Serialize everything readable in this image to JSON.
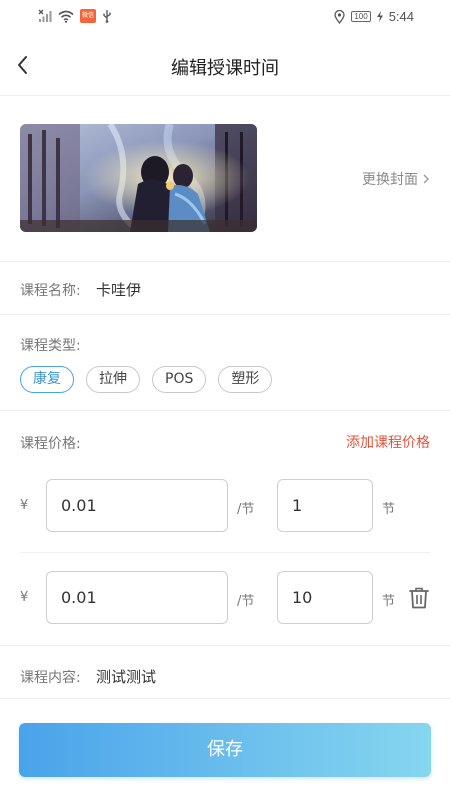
{
  "status_bar": {
    "carrier_badge": "微信",
    "battery": "100",
    "time": "5:44",
    "icons": [
      "no-signal-icon",
      "wifi-icon",
      "app-badge-icon",
      "usb-icon",
      "location-icon",
      "battery-icon",
      "charging-icon"
    ]
  },
  "header": {
    "title": "编辑授课时间",
    "back_icon": "chevron-left-icon"
  },
  "cover": {
    "change_label": "更换封面"
  },
  "course_name": {
    "label": "课程名称:",
    "value": "卡哇伊"
  },
  "course_type": {
    "label": "课程类型:",
    "options": [
      "康复",
      "拉伸",
      "POS",
      "塑形"
    ],
    "selected": "康复"
  },
  "price": {
    "label": "课程价格:",
    "add_label": "添加课程价格",
    "currency": "¥",
    "per_unit": "/节",
    "count_unit": "节",
    "items": [
      {
        "price": "0.01",
        "count": "1"
      },
      {
        "price": "0.01",
        "count": "10"
      }
    ]
  },
  "course_content": {
    "label": "课程内容:",
    "value": "测试测试"
  },
  "save_label": "保存",
  "colors": {
    "accent_blue": "#4ba3e3",
    "add_red": "#e2553d",
    "save_gradient_start": "#4aa3ea",
    "save_gradient_end": "#86d6ef"
  }
}
